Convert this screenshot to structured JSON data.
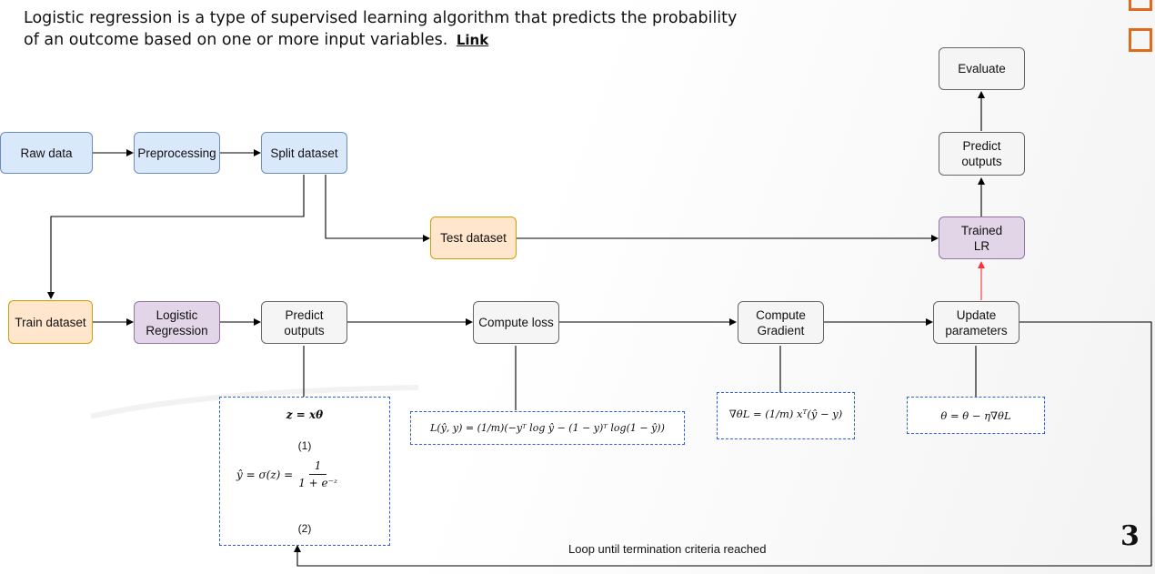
{
  "intro": {
    "text": "Logistic regression is a type of supervised learning algorithm that predicts the probability of an outcome based on one or more input variables.",
    "link_label": "Link"
  },
  "nodes": {
    "raw_data": "Raw data",
    "preprocessing": "Preprocessing",
    "split_dataset": "Split dataset",
    "test_dataset": "Test dataset",
    "train_dataset": "Train dataset",
    "logistic_regression": "Logistic\nRegression",
    "predict_outputs_train": "Predict\noutputs",
    "compute_loss": "Compute loss",
    "compute_gradient": "Compute\nGradient",
    "update_parameters": "Update\nparameters",
    "trained_lr": "Trained\nLR",
    "predict_outputs_eval": "Predict\noutputs",
    "evaluate": "Evaluate"
  },
  "formulas": {
    "linear": "z = xθ",
    "eq1_label": "(1)",
    "sigmoid_lhs": "ŷ = σ(z) =",
    "sigmoid_num": "1",
    "sigmoid_den": "1 + e⁻ᶻ",
    "eq2_label": "(2)",
    "loss": "L(ŷ, y) = (1/m)(−yᵀ log ŷ − (1 − y)ᵀ log(1 − ŷ))",
    "gradient": "∇θL = (1/m) xᵀ(ŷ − y)",
    "update": "θ = θ − η∇θL"
  },
  "loop_label": "Loop until termination criteria reached",
  "page_number": "3",
  "colors": {
    "blue_fill": "#dae8fc",
    "blue_stroke": "#6c8ebf",
    "grey_fill": "#f5f5f5",
    "orange_fill": "#ffe6cc",
    "purple_fill": "#e1d5e7",
    "accent_orange": "#e06a1b",
    "red_arrow": "#ff3333"
  }
}
